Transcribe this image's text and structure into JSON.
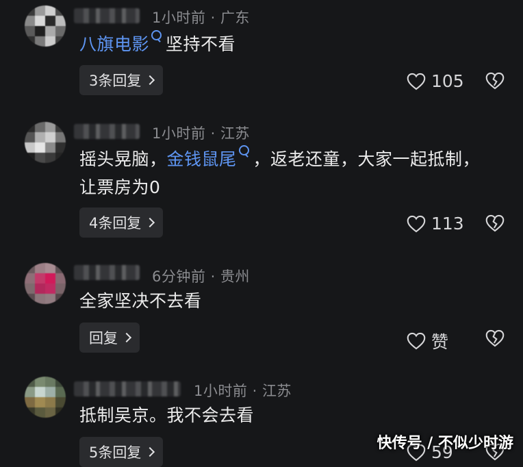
{
  "comments": [
    {
      "time": "1小时前",
      "location": "广东",
      "text_parts": {
        "link": "八旗电影",
        "after": "坚持不看"
      },
      "reply_label": "3条回复",
      "likes": "105"
    },
    {
      "time": "1小时前",
      "location": "江苏",
      "text_parts": {
        "before": "摇头晃脑，",
        "link": "金钱鼠尾",
        "after": "，返老还童，大家一起抵制，",
        "line2": "让票房为0"
      },
      "reply_label": "4条回复",
      "likes": "113"
    },
    {
      "time": "6分钟前",
      "location": "贵州",
      "text_parts": {
        "text": "全家坚决不去看"
      },
      "reply_label": "回复",
      "likes": "赞"
    },
    {
      "time": "1小时前",
      "location": "江苏",
      "text_parts": {
        "text": "抵制吴京。我不会去看"
      },
      "reply_label": "5条回复",
      "likes": "59"
    }
  ],
  "separator": "·",
  "watermark": "快传号 / 不似少时游",
  "icons": {
    "like": "heart-icon",
    "dislike": "broken-heart-icon",
    "link": "search-icon",
    "chevron": "chevron-right-icon"
  },
  "colors": {
    "background": "#161719",
    "link": "#5e95f2",
    "meta": "#8b8c90",
    "button_bg": "#2a2b2e"
  }
}
